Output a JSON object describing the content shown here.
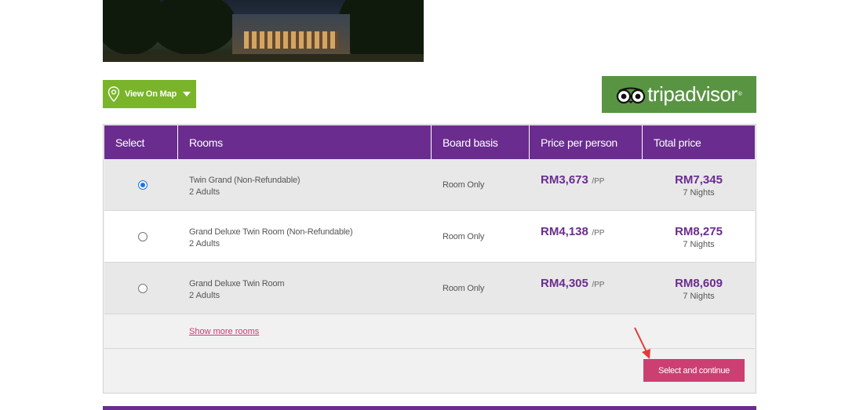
{
  "map_button": {
    "label": "View On Map",
    "icon": "map-pin-icon"
  },
  "tripadvisor": {
    "logo_text": "tripadvisor",
    "reg_mark": "®",
    "color": "#589442"
  },
  "table": {
    "headers": [
      "Select",
      "Rooms",
      "Board basis",
      "Price per person",
      "Total price"
    ],
    "rows": [
      {
        "selected": true,
        "room": "Twin Grand (Non-Refundable)",
        "occupancy": "2 Adults",
        "board": "Room Only",
        "price_pp": "RM3,673",
        "pp_unit": "/PP",
        "total": "RM7,345",
        "nights": "7 Nights"
      },
      {
        "selected": false,
        "room": "Grand Deluxe Twin Room (Non-Refundable)",
        "occupancy": "2 Adults",
        "board": "Room Only",
        "price_pp": "RM4,138",
        "pp_unit": "/PP",
        "total": "RM8,275",
        "nights": "7 Nights"
      },
      {
        "selected": false,
        "room": "Grand Deluxe Twin Room",
        "occupancy": "2 Adults",
        "board": "Room Only",
        "price_pp": "RM4,305",
        "pp_unit": "/PP",
        "total": "RM8,609",
        "nights": "7 Nights"
      }
    ],
    "show_more": "Show more rooms"
  },
  "continue_button": "Select and continue",
  "colors": {
    "header": "#6a2c8e",
    "accent": "#cc3f72",
    "map_green": "#7ab42a",
    "price": "#6a2c8e"
  }
}
